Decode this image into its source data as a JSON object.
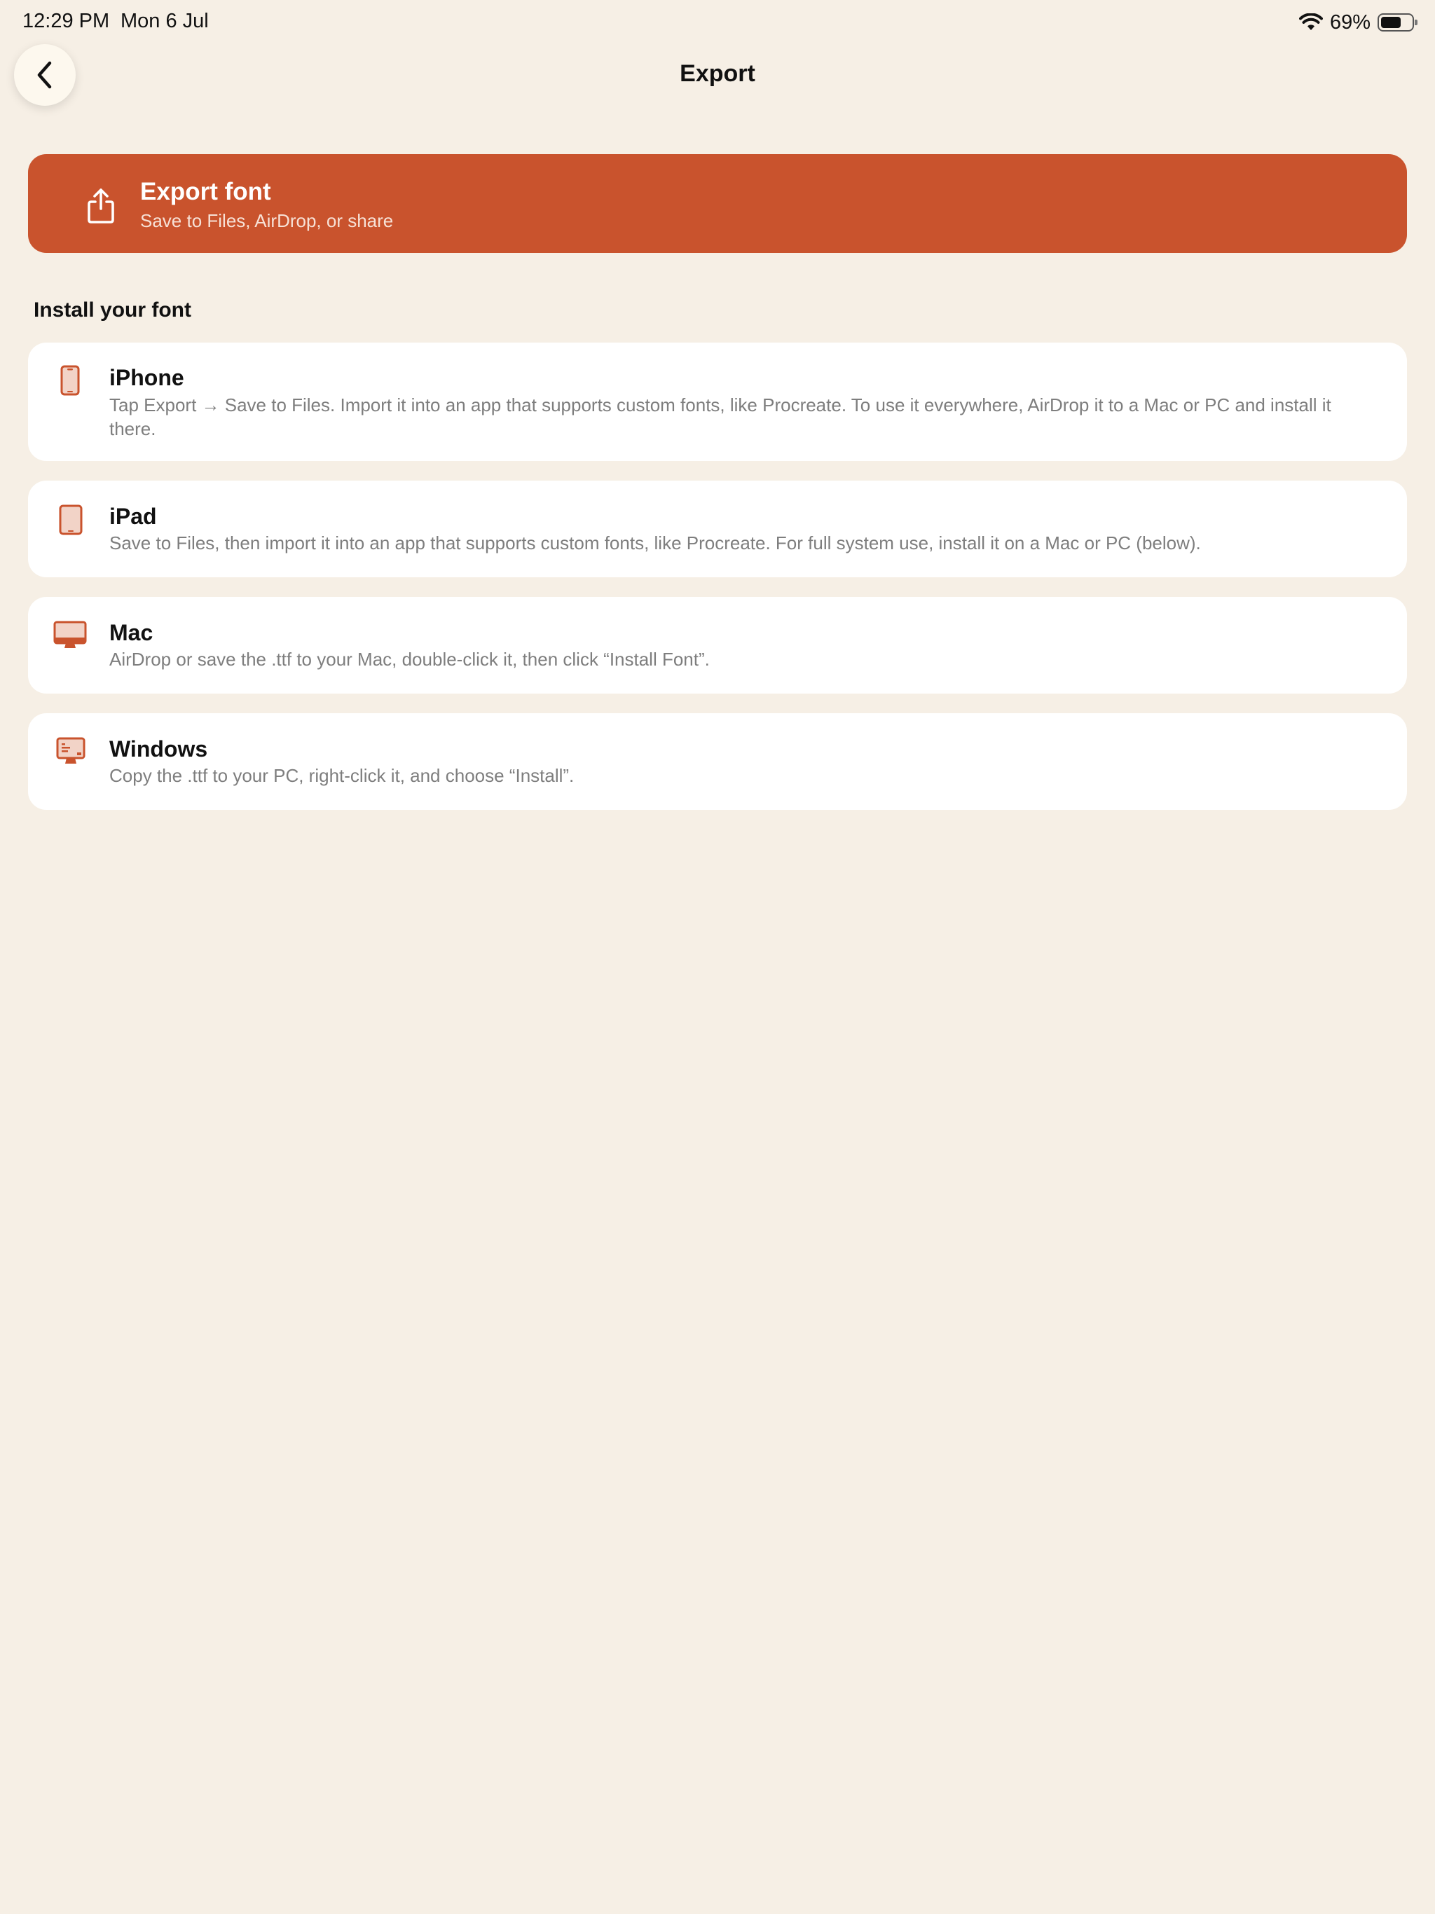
{
  "status_bar": {
    "time": "12:29 PM",
    "date": "Mon 6 Jul",
    "battery_percent": "69%",
    "battery_level": 0.69,
    "wifi_icon": "wifi-icon"
  },
  "nav": {
    "title": "Export",
    "back_icon": "chevron-left-icon"
  },
  "export_button": {
    "title": "Export font",
    "subtitle": "Save to Files, AirDrop, or share",
    "icon": "share-icon"
  },
  "section": {
    "title": "Install your font"
  },
  "platforms": [
    {
      "title": "iPhone",
      "body": "Tap Export → Save to Files. Import it into an app that supports custom fonts, like Procreate. To use it everywhere, AirDrop it to a Mac or PC and install it there.",
      "icon": "iphone-icon"
    },
    {
      "title": "iPad",
      "body": "Save to Files, then import it into an app that supports custom fonts, like Procreate. For full system use, install it on a Mac or PC (below).",
      "icon": "ipad-icon"
    },
    {
      "title": "Mac",
      "body": "AirDrop or save the .ttf to your Mac, double-click it, then click “Install Font”.",
      "icon": "imac-icon"
    },
    {
      "title": "Windows",
      "body": "Copy the .ttf to your PC, right-click it, and choose “Install”.",
      "icon": "pc-monitor-icon"
    }
  ],
  "colors": {
    "accent": "#C9532D",
    "background": "#F6EFE5",
    "card": "#FFFFFF",
    "secondary_text": "#7E7E7E"
  }
}
